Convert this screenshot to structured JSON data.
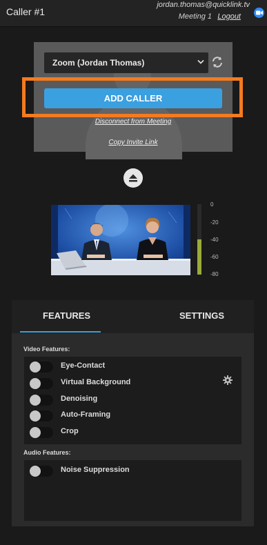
{
  "header": {
    "title": "Caller #1",
    "user_email": "jordan.thomas@quicklink.tv",
    "meeting_label": "Meeting 1",
    "logout_label": "Logout",
    "app_icon": "zoom-camera-icon",
    "accent_color": "#2d8cff"
  },
  "controls": {
    "caller_select": {
      "value": "Zoom (Jordan Thomas)"
    },
    "refresh_icon": "refresh-icon",
    "add_caller_label": "ADD CALLER",
    "disconnect_label": "Disconnect from Meeting",
    "invite_label": "Copy Invite Link",
    "highlight_color": "#f47b20",
    "button_color": "#3aa0e0"
  },
  "eject_icon": "eject-icon",
  "audio_meter": {
    "scale_labels": [
      "0",
      "-20",
      "-40",
      "-60",
      "-80"
    ],
    "level_db": -40,
    "fill_color": "#9aab3a"
  },
  "tabs": [
    {
      "label": "FEATURES",
      "active": true
    },
    {
      "label": "SETTINGS",
      "active": false
    }
  ],
  "video_features": {
    "heading": "Video Features:",
    "items": [
      {
        "label": "Eye-Contact",
        "on": false
      },
      {
        "label": "Virtual Background",
        "on": false
      },
      {
        "label": "Denoising",
        "on": false
      },
      {
        "label": "Auto-Framing",
        "on": false
      },
      {
        "label": "Crop",
        "on": false
      }
    ],
    "settings_icon": "gear-icon"
  },
  "audio_features": {
    "heading": "Audio Features:",
    "items": [
      {
        "label": "Noise Suppression",
        "on": false
      }
    ]
  }
}
